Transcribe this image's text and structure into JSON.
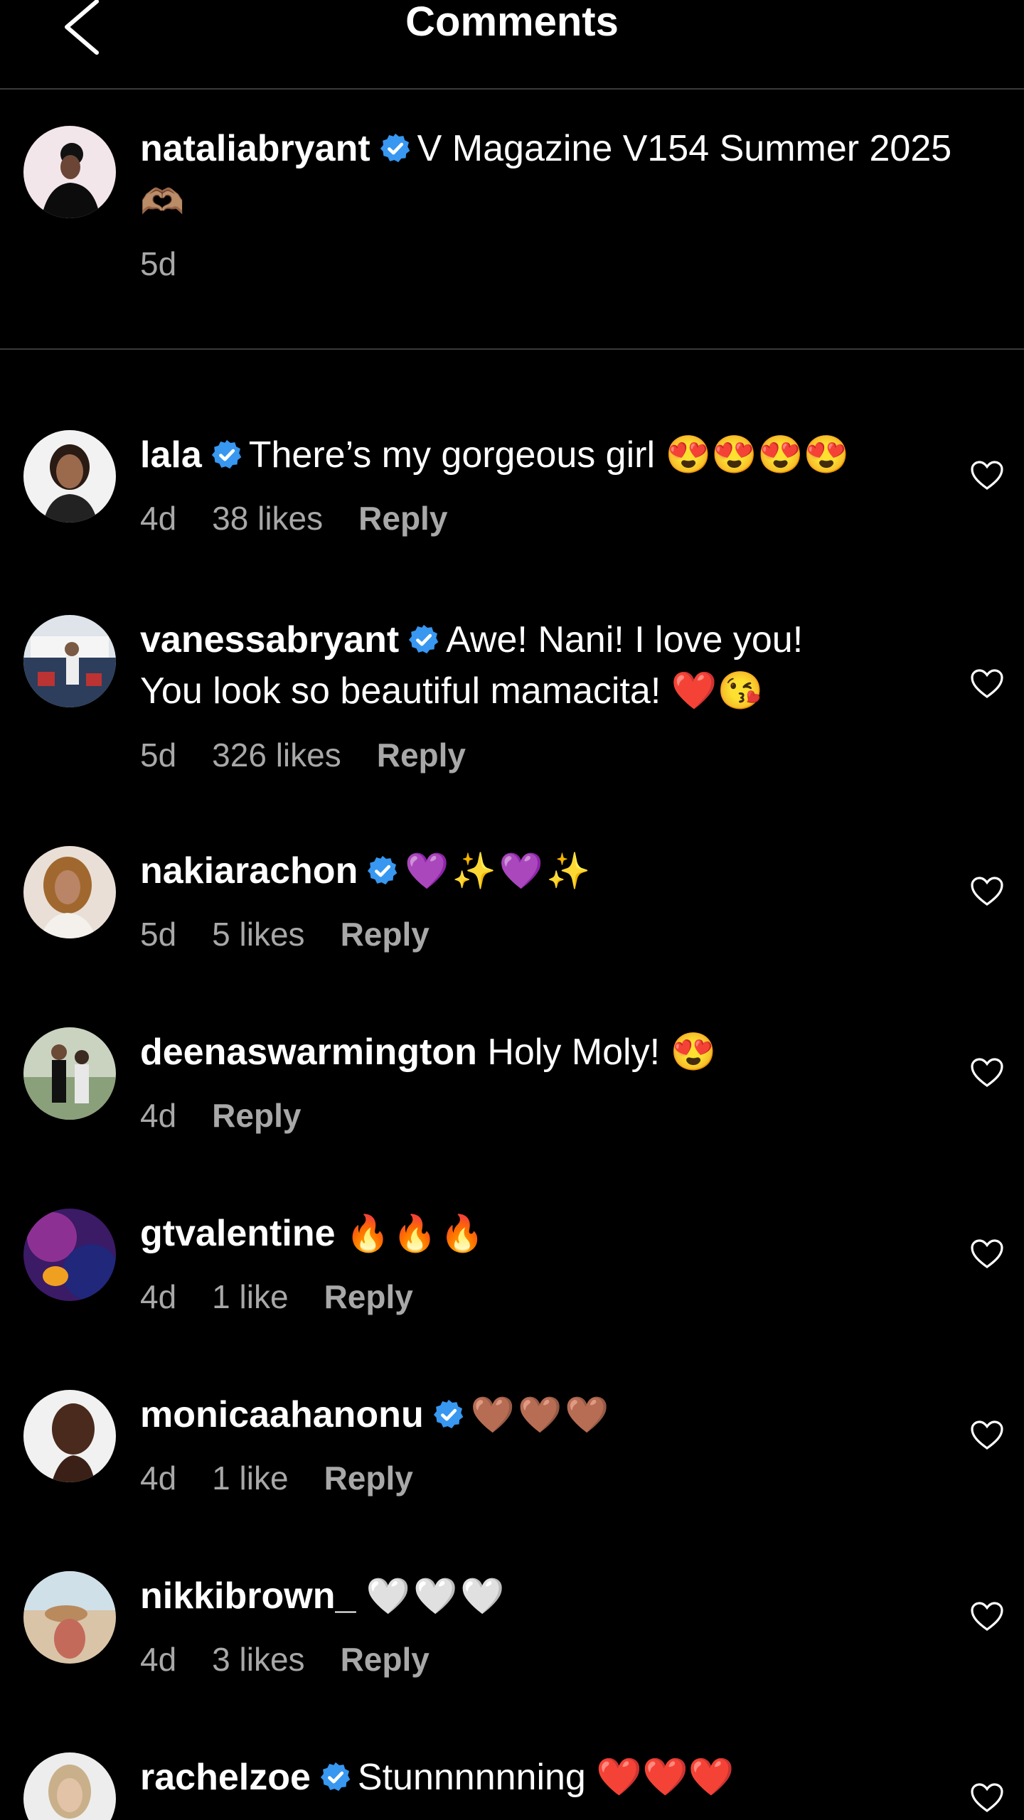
{
  "header": {
    "title": "Comments"
  },
  "caption": {
    "username": "nataliabryant",
    "text": "V Magazine V154 Summer 2025",
    "emoji": "🫶🏽",
    "time": "5d"
  },
  "comments": [
    {
      "username": "lala",
      "verified": true,
      "text": "There’s my gorgeous girl 😍😍😍😍",
      "line2": "",
      "time": "4d",
      "likes": "38 likes",
      "reply": "Reply"
    },
    {
      "username": "vanessabryant",
      "verified": true,
      "text": "Awe! Nani! I love you!",
      "line2": "You look so beautiful mamacita! ❤️😘",
      "time": "5d",
      "likes": "326 likes",
      "reply": "Reply"
    },
    {
      "username": "nakiarachon",
      "verified": true,
      "text": "💜✨💜✨",
      "line2": "",
      "time": "5d",
      "likes": "5 likes",
      "reply": "Reply"
    },
    {
      "username": "deenaswarmington",
      "verified": false,
      "text": "Holy Moly! 😍",
      "line2": "",
      "time": "4d",
      "likes": "",
      "reply": "Reply"
    },
    {
      "username": "gtvalentine",
      "verified": false,
      "text": "🔥🔥🔥",
      "line2": "",
      "time": "4d",
      "likes": "1 like",
      "reply": "Reply"
    },
    {
      "username": "monicaahanonu",
      "verified": true,
      "text": "🤎🤎🤎",
      "line2": "",
      "time": "4d",
      "likes": "1 like",
      "reply": "Reply"
    },
    {
      "username": "nikkibrown_",
      "verified": false,
      "text": "🤍🤍🤍",
      "line2": "",
      "time": "4d",
      "likes": "3 likes",
      "reply": "Reply"
    },
    {
      "username": "rachelzoe",
      "verified": true,
      "text": "Stunnnnnning ❤️❤️❤️",
      "line2": "",
      "time": "",
      "likes": "",
      "reply": ""
    }
  ],
  "colors": {
    "background": "#000000",
    "text": "#ffffff",
    "muted": "#a8a8a8",
    "verified": "#3897f0",
    "divider": "#3a3a3a"
  },
  "icons": {
    "back": "chevron-left-icon",
    "verified": "verified-badge-icon",
    "like": "heart-outline-icon"
  }
}
